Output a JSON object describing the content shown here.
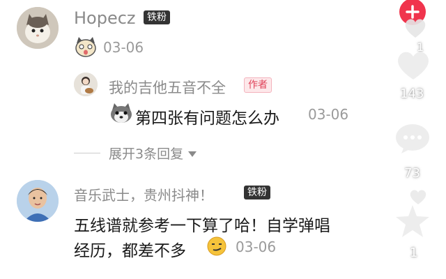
{
  "comments": [
    {
      "author": "Hopecz",
      "badge": "铁粉",
      "time": "03-06"
    },
    {
      "reply_author": "我的吉他五音不全",
      "reply_badge": "作者",
      "reply_text": "第四张有问题怎么办",
      "reply_time": "03-06",
      "expand_label": "展开3条回复"
    },
    {
      "author": "音乐武士，贵州抖神！",
      "badge": "铁粉",
      "text_line1": "五线谱就参考一下算了哈！自学弹唱",
      "text_line2": "经历，都差不多",
      "time": "03-06"
    }
  ],
  "right_rail": {
    "counts": [
      "1",
      "143",
      "73",
      "1"
    ]
  },
  "colors": {
    "plus_button": "#f0344d",
    "badge_dark": "#333333",
    "author_badge_text": "#e0435a"
  }
}
